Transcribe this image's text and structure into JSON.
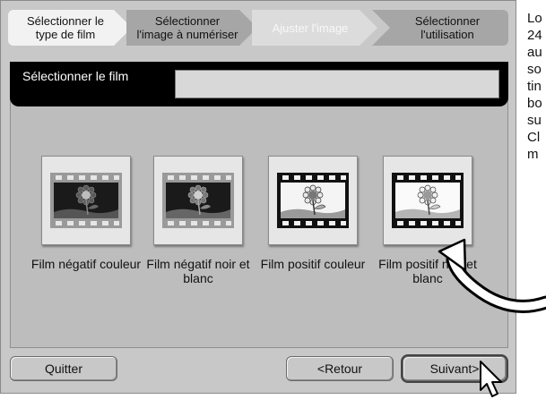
{
  "steps": [
    {
      "label": "Sélectionner le type de film",
      "state": "active"
    },
    {
      "label": "Sélectionner l'image à numériser",
      "state": "done"
    },
    {
      "label": "Ajuster l'image",
      "state": "future"
    },
    {
      "label": "Sélectionner l'utilisation",
      "state": "done"
    }
  ],
  "section": {
    "title": "Sélectionner le film"
  },
  "film_types": [
    {
      "label": "Film négatif couleur",
      "icon": "negative-color-film-icon"
    },
    {
      "label": "Film négatif noir et blanc",
      "icon": "negative-bw-film-icon"
    },
    {
      "label": "Film positif couleur",
      "icon": "positive-color-film-icon"
    },
    {
      "label": "Film positif noir et blanc",
      "icon": "positive-bw-film-icon"
    }
  ],
  "buttons": {
    "quit": "Quitter",
    "back": "<Retour",
    "next": "Suivant>"
  },
  "side_text": [
    "Lo",
    "24",
    "au",
    "so",
    "tin",
    "bo",
    "su",
    "Cl",
    "m"
  ],
  "colors": {
    "panel": "#c8c8c8",
    "title_bar": "#000000",
    "film_dark": "#1a1a1a",
    "sprocket": "#9a9a9a"
  }
}
